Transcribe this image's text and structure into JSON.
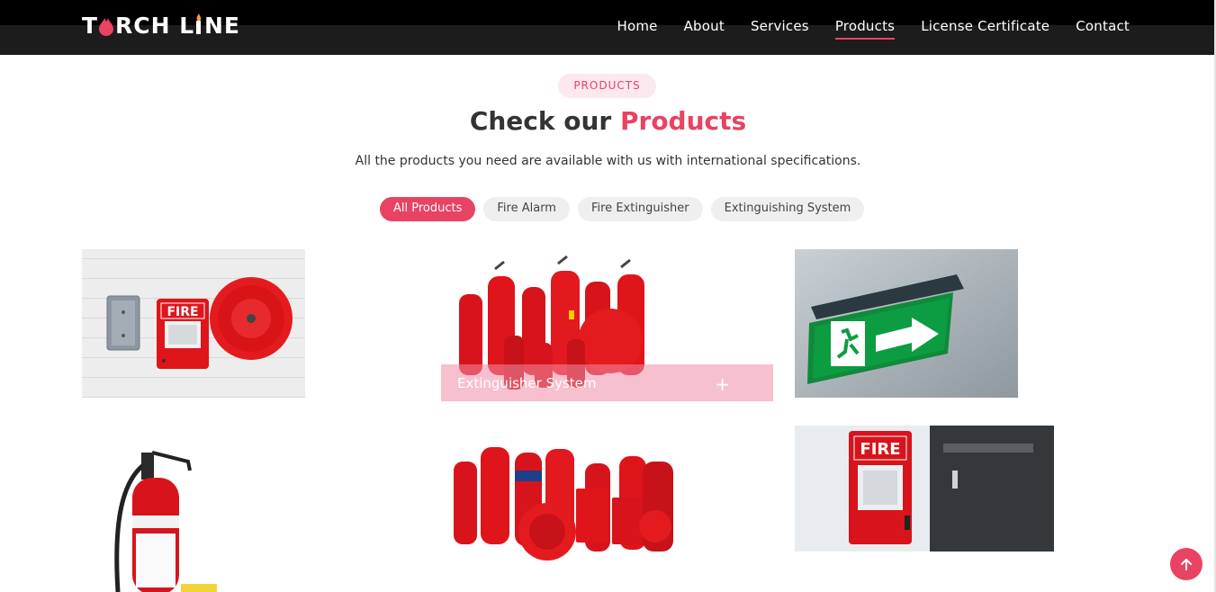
{
  "header": {
    "logo_text": "TORCH LINE",
    "nav": [
      {
        "label": "Home",
        "active": false
      },
      {
        "label": "About",
        "active": false
      },
      {
        "label": "Services",
        "active": false
      },
      {
        "label": "Products",
        "active": true
      },
      {
        "label": "License Certificate",
        "active": false
      },
      {
        "label": "Contact",
        "active": false
      }
    ]
  },
  "section": {
    "badge": "PRODUCTS",
    "title_prefix": "Check our",
    "title_accent": "Products",
    "subtitle": "All the products you need are available with us with international specifications."
  },
  "filters": [
    {
      "label": "All Products",
      "active": true
    },
    {
      "label": "Fire Alarm",
      "active": false
    },
    {
      "label": "Fire Extinguisher",
      "active": false
    },
    {
      "label": "Extinguishing System",
      "active": false
    }
  ],
  "products": {
    "hover_label": "Extinguisher System",
    "hover_action": "+"
  },
  "colors": {
    "accent": "#e84363",
    "header_bg": "#1c1c1c",
    "exit_sign_green": "#0f8a3a"
  },
  "icons": {
    "back_to_top": "arrow-up-icon"
  }
}
